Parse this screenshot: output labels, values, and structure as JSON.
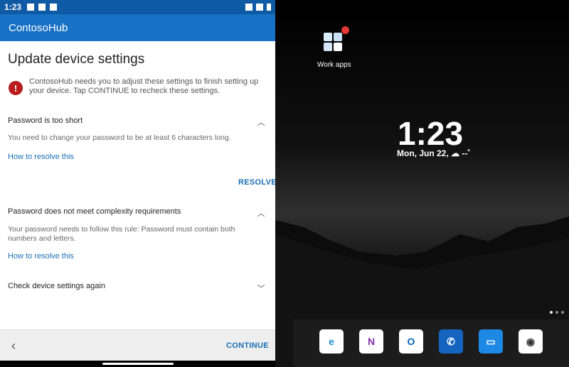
{
  "status": {
    "time": "1:23"
  },
  "appbar": {
    "title": "ContosoHub"
  },
  "page": {
    "title": "Update device settings",
    "alert_text": "ContosoHub needs you to adjust these settings to finish setting up your device. Tap CONTINUE to recheck these settings.",
    "alert_icon": "!"
  },
  "sections": [
    {
      "title": "Password is too short",
      "body": "You need to change your password to be at least 6 characters long.",
      "link": "How to resolve this",
      "action": "RESOLVE"
    },
    {
      "title": "Password does not meet complexity requirements",
      "body": "Your password needs to follow this rule: Password must contain both numbers and letters.",
      "link": "How to resolve this"
    },
    {
      "title": "Check device settings again"
    }
  ],
  "bottom": {
    "continue_label": "CONTINUE",
    "back_icon": "back-arrow-icon"
  },
  "home": {
    "folder_label": "Work apps",
    "clock": "1:23",
    "date": "Mon, Jun 22,",
    "weather": "☁ --˚"
  },
  "dock": [
    {
      "name": "edge-icon",
      "glyph": "e",
      "color": "#1b8bd1"
    },
    {
      "name": "onenote-icon",
      "glyph": "N",
      "color": "#7b2fa6"
    },
    {
      "name": "outlook-icon",
      "glyph": "O",
      "color": "#0a64b8"
    },
    {
      "name": "phone-icon",
      "glyph": "✆",
      "color": "#ffffff"
    },
    {
      "name": "messages-icon",
      "glyph": "▭",
      "color": "#ffffff"
    },
    {
      "name": "camera-icon",
      "glyph": "◉",
      "color": "#333333"
    }
  ],
  "colors": {
    "statusbar": "#0f5aa5",
    "appbar": "#1771c4",
    "link": "#1a6fb6",
    "alert": "#b91c1c"
  }
}
